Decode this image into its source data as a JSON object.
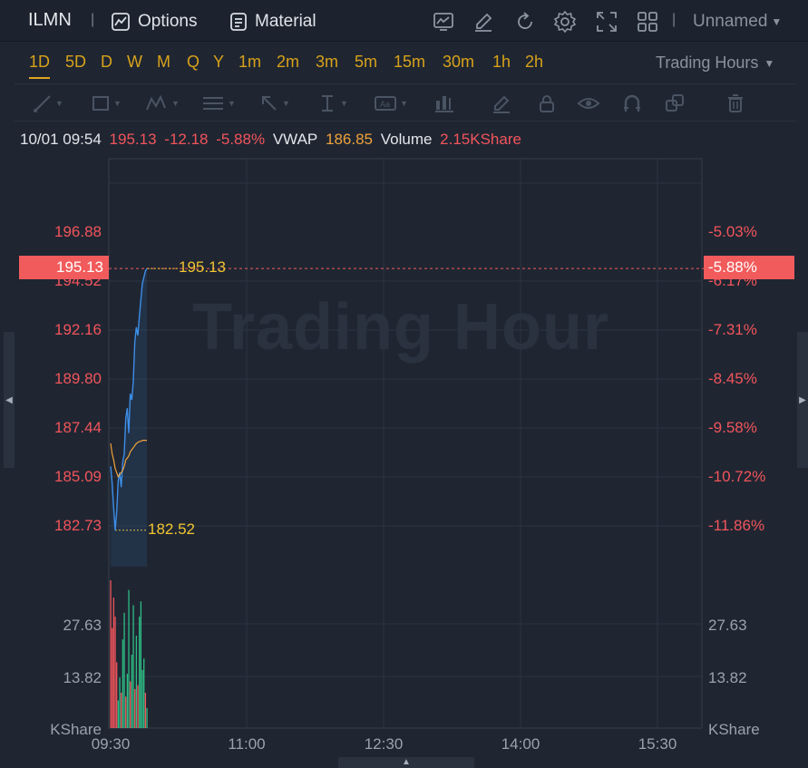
{
  "header": {
    "ticker": "ILMN",
    "options_label": "Options",
    "material_label": "Material",
    "layout_name": "Unnamed",
    "icons": [
      "chart-icon",
      "edit-icon",
      "refresh-icon",
      "gear-icon",
      "fullscreen-icon",
      "grid-icon"
    ]
  },
  "timeframes": [
    "1D",
    "5D",
    "D",
    "W",
    "M",
    "Q",
    "Y",
    "1m",
    "2m",
    "3m",
    "5m",
    "15m",
    "30m",
    "1h",
    "2h"
  ],
  "active_timeframe": "1D",
  "trading_hours_label": "Trading Hours",
  "drawing_tools": [
    "line-tool-icon",
    "rectangle-tool-icon",
    "pattern-tool-icon",
    "fib-tool-icon",
    "arrow-tool-icon",
    "measure-tool-icon",
    "text-tool-icon",
    "indicator-tool-icon",
    "pencil-icon",
    "lock-icon",
    "eye-icon",
    "magnet-icon",
    "clone-icon",
    "trash-icon"
  ],
  "info": {
    "datetime": "10/01 09:54",
    "price": "195.13",
    "change": "-12.18",
    "change_pct": "-5.88%",
    "vwap_label": "VWAP",
    "vwap_value": "186.85",
    "volume_label": "Volume",
    "volume_value": "2.15KShare"
  },
  "watermark": "Trading Hour",
  "axis": {
    "price_labels": [
      "196.88",
      "194.52",
      "192.16",
      "189.80",
      "187.44",
      "185.09",
      "182.73"
    ],
    "pct_labels": [
      "-5.03%",
      "-6.17%",
      "-7.31%",
      "-8.45%",
      "-9.58%",
      "-10.72%",
      "-11.86%"
    ],
    "current_price": "195.13",
    "current_pct": "-5.88%",
    "high_marker": "195.13",
    "low_marker": "182.52",
    "volume_labels": [
      "27.63",
      "13.82"
    ],
    "volume_unit": "KShare",
    "time_labels": [
      "09:30",
      "11:00",
      "12:30",
      "14:00",
      "15:30"
    ]
  },
  "colors": {
    "up": "#2ebd85",
    "down": "#f2545b",
    "price_line": "#3d8ee8",
    "vwap_line": "#f0a23a",
    "accent": "#e2a41d"
  },
  "chart_data": {
    "type": "line",
    "price_range": [
      182.0,
      198.5
    ],
    "x": [
      "09:30",
      "09:31",
      "09:32",
      "09:33",
      "09:34",
      "09:35",
      "09:36",
      "09:37",
      "09:38",
      "09:39",
      "09:40",
      "09:41",
      "09:42",
      "09:43",
      "09:44",
      "09:45",
      "09:46",
      "09:47",
      "09:48",
      "09:49",
      "09:50",
      "09:51",
      "09:52",
      "09:53",
      "09:54"
    ],
    "series": [
      {
        "values": [
          185.6,
          184.8,
          183.6,
          182.52,
          183.4,
          184.9,
          185.3,
          184.6,
          185.8,
          186.2,
          187.9,
          188.4,
          187.2,
          189.1,
          188.8,
          189.7,
          191.6,
          192.3,
          191.9,
          192.8,
          193.6,
          194.4,
          194.7,
          195.0,
          195.13
        ]
      },
      {
        "values": [
          186.7,
          186.2,
          185.9,
          185.5,
          185.3,
          185.1,
          185.2,
          185.3,
          185.4,
          185.6,
          185.9,
          186.0,
          186.1,
          186.3,
          186.4,
          186.5,
          186.6,
          186.7,
          186.75,
          186.8,
          186.8,
          186.85,
          186.85,
          186.85,
          186.85
        ]
      }
    ],
    "volume_range": [
      0,
      40
    ],
    "volume": [
      41,
      27,
      35,
      30,
      18,
      8,
      14,
      10,
      24,
      31,
      9,
      15,
      37,
      13,
      20,
      33,
      11,
      25,
      12,
      30,
      34,
      16,
      19,
      10,
      6
    ],
    "volume_up": [
      false,
      false,
      false,
      false,
      false,
      true,
      true,
      false,
      true,
      true,
      false,
      true,
      true,
      false,
      true,
      true,
      false,
      true,
      false,
      true,
      true,
      true,
      true,
      false,
      true
    ],
    "y_ticks": [
      "196.88",
      "194.52",
      "192.16",
      "189.80",
      "187.44",
      "185.09",
      "182.73"
    ],
    "x_ticks": [
      "09:30",
      "11:00",
      "12:30",
      "14:00",
      "15:30"
    ]
  }
}
